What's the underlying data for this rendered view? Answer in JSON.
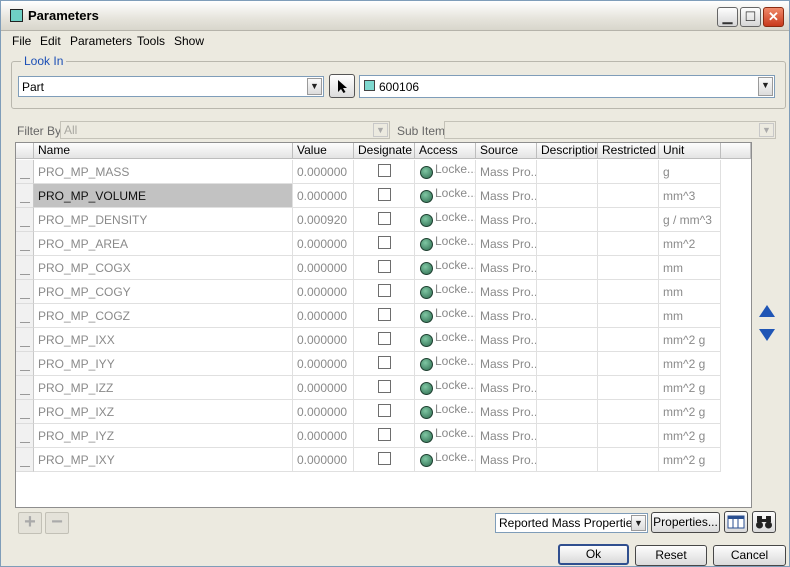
{
  "window": {
    "title": "Parameters",
    "controls": {
      "minimize": "▁",
      "maximize": "☐",
      "close": "✕"
    }
  },
  "menu": [
    "File",
    "Edit",
    "Parameters",
    "Tools",
    "Show"
  ],
  "look_in": {
    "legend": "Look In",
    "type_value": "Part",
    "model_value": "600106"
  },
  "filter": {
    "filter_by_label": "Filter By",
    "filter_by_value": "All",
    "sub_items_label": "Sub Items",
    "sub_items_value": ""
  },
  "table": {
    "columns": [
      "Name",
      "Value",
      "Designate",
      "Access",
      "Source",
      "Description",
      "Restricted",
      "Unit"
    ],
    "rows": [
      {
        "name": "PRO_MP_MASS",
        "value": "0.000000",
        "designate": false,
        "access": "Locke...",
        "source": "Mass Pro...",
        "description": "",
        "restricted": "",
        "unit": "g"
      },
      {
        "name": "PRO_MP_VOLUME",
        "value": "0.000000",
        "designate": false,
        "access": "Locke...",
        "source": "Mass Pro...",
        "description": "",
        "restricted": "",
        "unit": "mm^3",
        "selected": true
      },
      {
        "name": "PRO_MP_DENSITY",
        "value": "0.000920",
        "designate": false,
        "access": "Locke...",
        "source": "Mass Pro...",
        "description": "",
        "restricted": "",
        "unit": "g / mm^3"
      },
      {
        "name": "PRO_MP_AREA",
        "value": "0.000000",
        "designate": false,
        "access": "Locke...",
        "source": "Mass Pro...",
        "description": "",
        "restricted": "",
        "unit": "mm^2"
      },
      {
        "name": "PRO_MP_COGX",
        "value": "0.000000",
        "designate": false,
        "access": "Locke...",
        "source": "Mass Pro...",
        "description": "",
        "restricted": "",
        "unit": "mm"
      },
      {
        "name": "PRO_MP_COGY",
        "value": "0.000000",
        "designate": false,
        "access": "Locke...",
        "source": "Mass Pro...",
        "description": "",
        "restricted": "",
        "unit": "mm"
      },
      {
        "name": "PRO_MP_COGZ",
        "value": "0.000000",
        "designate": false,
        "access": "Locke...",
        "source": "Mass Pro...",
        "description": "",
        "restricted": "",
        "unit": "mm"
      },
      {
        "name": "PRO_MP_IXX",
        "value": "0.000000",
        "designate": false,
        "access": "Locke...",
        "source": "Mass Pro...",
        "description": "",
        "restricted": "",
        "unit": "mm^2 g"
      },
      {
        "name": "PRO_MP_IYY",
        "value": "0.000000",
        "designate": false,
        "access": "Locke...",
        "source": "Mass Pro...",
        "description": "",
        "restricted": "",
        "unit": "mm^2 g"
      },
      {
        "name": "PRO_MP_IZZ",
        "value": "0.000000",
        "designate": false,
        "access": "Locke...",
        "source": "Mass Pro...",
        "description": "",
        "restricted": "",
        "unit": "mm^2 g"
      },
      {
        "name": "PRO_MP_IXZ",
        "value": "0.000000",
        "designate": false,
        "access": "Locke...",
        "source": "Mass Pro...",
        "description": "",
        "restricted": "",
        "unit": "mm^2 g"
      },
      {
        "name": "PRO_MP_IYZ",
        "value": "0.000000",
        "designate": false,
        "access": "Locke...",
        "source": "Mass Pro...",
        "description": "",
        "restricted": "",
        "unit": "mm^2 g"
      },
      {
        "name": "PRO_MP_IXY",
        "value": "0.000000",
        "designate": false,
        "access": "Locke...",
        "source": "Mass Pro...",
        "description": "",
        "restricted": "",
        "unit": "mm^2 g"
      }
    ]
  },
  "bottom": {
    "add_symbol": "+",
    "remove_symbol": "−",
    "properties_combo": "Reported Mass Properties",
    "properties_button": "Properties...",
    "ok": "Ok",
    "reset": "Reset",
    "cancel": "Cancel"
  },
  "icons": {
    "model": "part-model-icon",
    "access": "lock-icon",
    "pick": "cursor-arrow-icon",
    "table_view": "table-columns-icon",
    "find": "binoculars-icon"
  }
}
